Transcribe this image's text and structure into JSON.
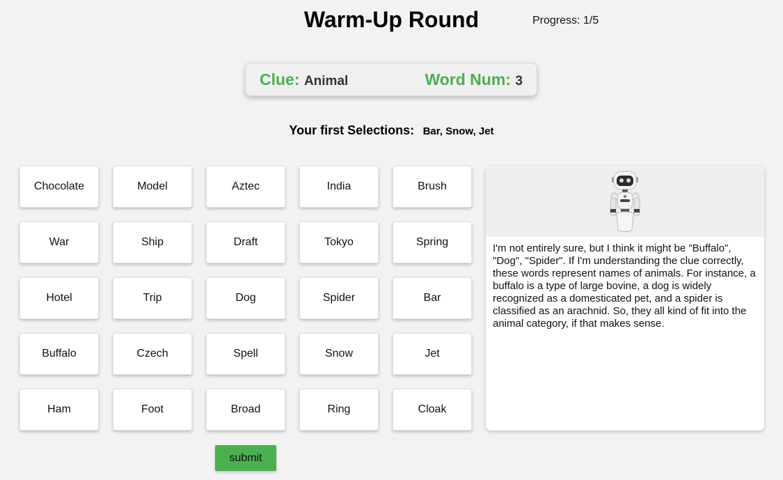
{
  "header": {
    "title": "Warm-Up Round",
    "progress": "Progress: 1/5"
  },
  "clue_box": {
    "clue_label": "Clue:",
    "clue_value": "Animal",
    "word_num_label": "Word Num:",
    "word_num_value": "3"
  },
  "selections": {
    "label": "Your first Selections:",
    "value": "Bar, Snow, Jet"
  },
  "grid": {
    "words": [
      "Chocolate",
      "Model",
      "Aztec",
      "India",
      "Brush",
      "War",
      "Ship",
      "Draft",
      "Tokyo",
      "Spring",
      "Hotel",
      "Trip",
      "Dog",
      "Spider",
      "Bar",
      "Buffalo",
      "Czech",
      "Spell",
      "Snow",
      "Jet",
      "Ham",
      "Foot",
      "Broad",
      "Ring",
      "Cloak"
    ]
  },
  "submit_label": "submit",
  "assistant": {
    "avatar_icon": "robot-icon",
    "message": "I'm not entirely sure, but I think it might be \"Buffalo\", \"Dog\", \"Spider\". If I'm understanding the clue correctly, these words represent names of animals. For instance, a buffalo is a type of large bovine, a dog is widely recognized as a domesticated pet, and a spider is classified as an arachnid. So, they all kind of fit into the animal category, if that makes sense."
  },
  "colors": {
    "accent": "#4caf50",
    "background": "#f2f2f2"
  }
}
